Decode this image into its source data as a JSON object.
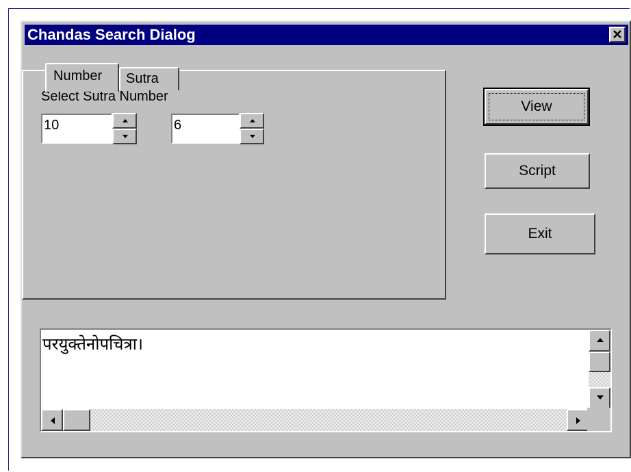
{
  "window": {
    "title": "Chandas Search Dialog",
    "close_icon": "close-icon"
  },
  "tabs": [
    {
      "label": "Number",
      "active": true
    },
    {
      "label": "Sutra",
      "active": false
    }
  ],
  "number_tab": {
    "select_label": "Select Sutra Number",
    "spinner1_value": "10",
    "spinner2_value": "6"
  },
  "buttons": {
    "view": "View",
    "script": "Script",
    "exit": "Exit"
  },
  "output": {
    "text": "परयुक्तेनोपचित्रा।"
  },
  "colors": {
    "titlebar": "#000080",
    "face": "#c0c0c0"
  }
}
